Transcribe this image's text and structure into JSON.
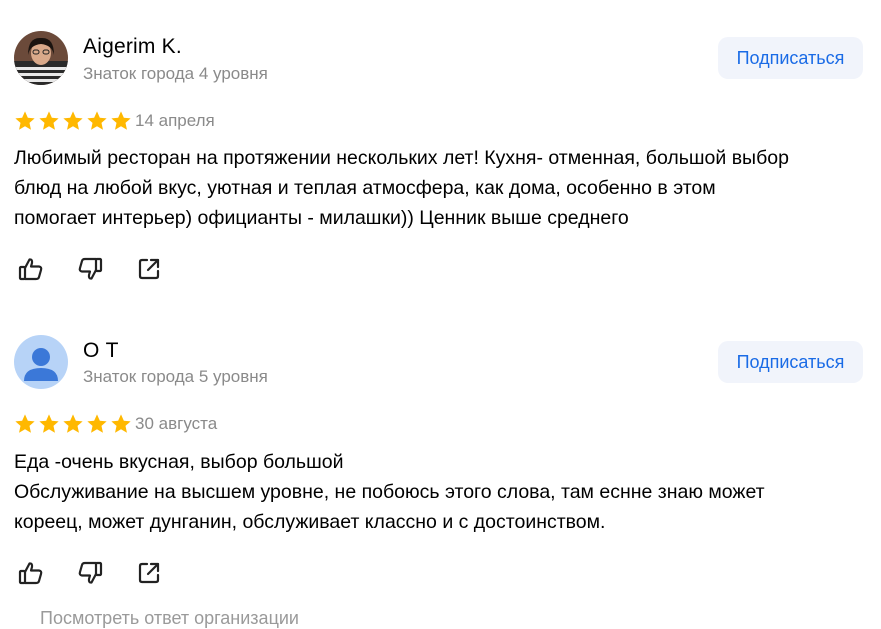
{
  "reviews": [
    {
      "author": "Aigerim K.",
      "level": "Знаток города 4 уровня",
      "subscribe_label": "Подписаться",
      "rating": 5,
      "date": "14 апреля",
      "text_lines": [
        "Любимый ресторан на протяжении нескольких лет! Кухня- отменная, большой выбор",
        "блюд на любой вкус, уютная и теплая атмосфера, как дома, особенно в этом",
        "помогает интерьер) официанты - милашки)) Ценник выше среднего"
      ],
      "avatar_icon": "user-photo"
    },
    {
      "author": "О Т",
      "level": "Знаток города 5 уровня",
      "subscribe_label": "Подписаться",
      "rating": 5,
      "date": "30 августа",
      "text_lines": [
        "Еда -очень вкусная, выбор большой",
        "Обслуживание на высшем уровне, не побоюсь этого слова, там еснне знаю может",
        "кореец, может дунганин, обслуживает классно и с достоинством."
      ],
      "avatar_icon": "default-user-icon"
    }
  ],
  "actions": {
    "like_icon": "thumbs-up-icon",
    "dislike_icon": "thumbs-down-icon",
    "share_icon": "share-icon"
  },
  "more_link": "Посмотреть ответ организации",
  "colors": {
    "star": "#ffb800",
    "accent": "#1a6be6",
    "secondary_text": "#8a8a8a",
    "button_bg": "#f1f4fb"
  }
}
